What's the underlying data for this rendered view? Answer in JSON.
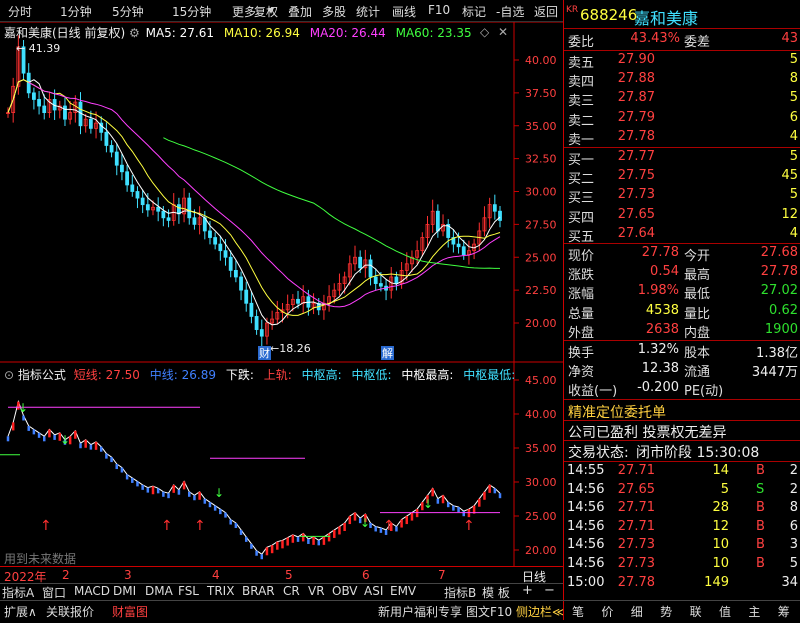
{
  "toolbar": {
    "periods": [
      "分时",
      "1分钟",
      "5分钟",
      "15分钟",
      "更多"
    ],
    "actions": [
      "复权",
      "叠加",
      "多股",
      "统计",
      "画线",
      "F10",
      "标记",
      "-自选",
      "返回"
    ]
  },
  "main_chart": {
    "title": "嘉和美康(日线 前复权)",
    "ma": [
      {
        "label": "MA5: 27.61",
        "color": "#ffffff"
      },
      {
        "label": "MA10: 26.94",
        "color": "#ffff40"
      },
      {
        "label": "MA20: 26.44",
        "color": "#ff40ff"
      },
      {
        "label": "MA60: 23.35",
        "color": "#40ff40"
      }
    ],
    "high_mark": "41.39",
    "low_mark": "18.26",
    "badges": [
      "财",
      "解"
    ],
    "y_ticks": [
      "40.00",
      "37.50",
      "35.00",
      "32.50",
      "30.00",
      "27.50",
      "25.00",
      "22.50",
      "20.00"
    ]
  },
  "indicator": {
    "title": "指标公式",
    "items": [
      {
        "label": "短线: 27.50",
        "color": "#ff4040"
      },
      {
        "label": "中线: 26.89",
        "color": "#4080ff"
      },
      {
        "label": "下跌:",
        "color": "#ffffff"
      },
      {
        "label": "上轨:",
        "color": "#ff4040"
      },
      {
        "label": "中枢高:",
        "color": "#40e0ff"
      },
      {
        "label": "中枢低:",
        "color": "#40e0ff"
      },
      {
        "label": "中枢最高:",
        "color": "#ffffff"
      },
      {
        "label": "中枢最低:",
        "color": "#40e0ff"
      }
    ],
    "y_ticks": [
      "45.00",
      "40.00",
      "35.00",
      "30.00",
      "25.00",
      "20.00"
    ],
    "watermark": "用到未来数据"
  },
  "x_axis": {
    "labels": [
      "2022年",
      "2",
      "3",
      "4",
      "5",
      "6",
      "7"
    ],
    "period": "日线"
  },
  "indicator_tabs": [
    "指标A",
    "窗口",
    "MACD",
    "DMI",
    "DMA",
    "FSL",
    "TRIX",
    "BRAR",
    "CR",
    "VR",
    "OBV",
    "ASI",
    "EMV",
    "指标B",
    "模 板"
  ],
  "bottom_bar": {
    "left": [
      "扩展∧",
      "关联报价",
      "财富图"
    ],
    "right": [
      "新用户福利专享",
      "图文F10",
      "侧边栏≪"
    ]
  },
  "quote": {
    "prefix": "KR",
    "code": "688246",
    "name": "嘉和美康",
    "webi": {
      "label": "委比",
      "value": "43.43%"
    },
    "weicha": {
      "label": "委差",
      "value": "43"
    },
    "sells": [
      {
        "label": "卖五",
        "price": "27.90",
        "vol": "5"
      },
      {
        "label": "卖四",
        "price": "27.88",
        "vol": "8"
      },
      {
        "label": "卖三",
        "price": "27.87",
        "vol": "5"
      },
      {
        "label": "卖二",
        "price": "27.79",
        "vol": "6"
      },
      {
        "label": "卖一",
        "price": "27.78",
        "vol": "4"
      }
    ],
    "buys": [
      {
        "label": "买一",
        "price": "27.77",
        "vol": "5"
      },
      {
        "label": "买二",
        "price": "27.75",
        "vol": "45"
      },
      {
        "label": "买三",
        "price": "27.73",
        "vol": "5"
      },
      {
        "label": "买四",
        "price": "27.65",
        "vol": "12"
      },
      {
        "label": "买五",
        "price": "27.64",
        "vol": "4"
      }
    ],
    "stats": [
      {
        "l1": "现价",
        "v1": "27.78",
        "c1": "#ff4040",
        "l2": "今开",
        "v2": "27.68",
        "c2": "#ff4040"
      },
      {
        "l1": "涨跌",
        "v1": "0.54",
        "c1": "#ff4040",
        "l2": "最高",
        "v2": "27.78",
        "c2": "#ff4040"
      },
      {
        "l1": "涨幅",
        "v1": "1.98%",
        "c1": "#ff4040",
        "l2": "最低",
        "v2": "27.02",
        "c2": "#2ee02e"
      },
      {
        "l1": "总量",
        "v1": "4538",
        "c1": "#ffff40",
        "l2": "量比",
        "v2": "0.62",
        "c2": "#2ee02e"
      },
      {
        "l1": "外盘",
        "v1": "2638",
        "c1": "#ff4040",
        "l2": "内盘",
        "v2": "1900",
        "c2": "#2ee02e"
      }
    ],
    "stats2": [
      {
        "l1": "换手",
        "v1": "1.32%",
        "l2": "股本",
        "v2": "1.38亿"
      },
      {
        "l1": "净资",
        "v1": "12.38",
        "l2": "流通",
        "v2": "3447万"
      },
      {
        "l1": "收益(一)",
        "v1": "-0.200",
        "l2": "PE(动)",
        "v2": ""
      }
    ],
    "banner": "精准定位委托单",
    "info": "公司已盈利 投票权无差异",
    "status_label": "交易状态:",
    "status_value": "闭市阶段 15:30:08",
    "ticks": [
      {
        "time": "14:55",
        "price": "27.71",
        "vol": "14",
        "side": "B",
        "n": "2"
      },
      {
        "time": "14:56",
        "price": "27.65",
        "vol": "5",
        "side": "S",
        "n": "2"
      },
      {
        "time": "14:56",
        "price": "27.71",
        "vol": "28",
        "side": "B",
        "n": "8"
      },
      {
        "time": "14:56",
        "price": "27.71",
        "vol": "12",
        "side": "B",
        "n": "6"
      },
      {
        "time": "14:56",
        "price": "27.73",
        "vol": "10",
        "side": "B",
        "n": "3"
      },
      {
        "time": "14:56",
        "price": "27.73",
        "vol": "10",
        "side": "B",
        "n": "5"
      },
      {
        "time": "15:00",
        "price": "27.78",
        "vol": "149",
        "side": "",
        "n": "34"
      }
    ],
    "tabs": [
      "笔",
      "价",
      "细",
      "势",
      "联",
      "值",
      "主",
      "筹"
    ]
  }
}
